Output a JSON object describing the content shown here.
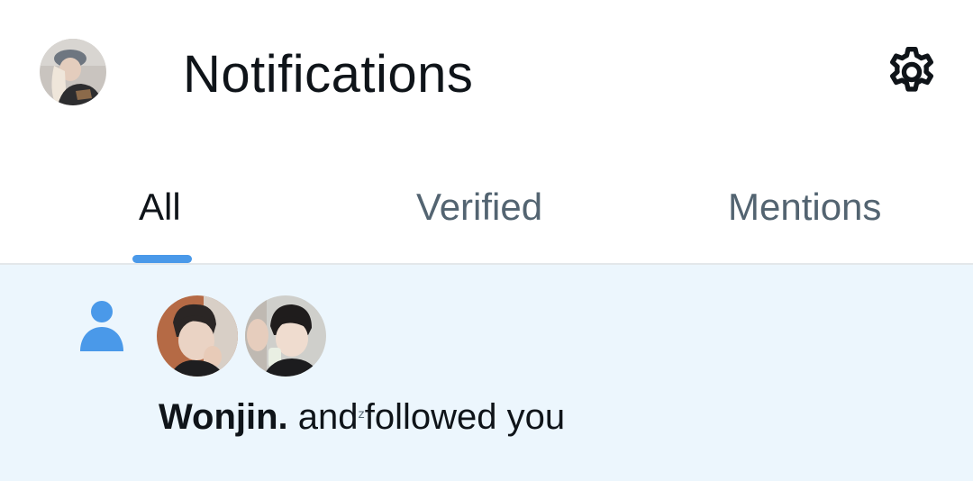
{
  "header": {
    "title": "Notifications",
    "profile_avatar": "profile-avatar",
    "settings_icon": "gear-icon"
  },
  "tabs": [
    {
      "label": "All",
      "active": true
    },
    {
      "label": "Verified",
      "active": false
    },
    {
      "label": "Mentions",
      "active": false
    }
  ],
  "notification": {
    "type_icon": "person-icon",
    "user_name": "Wonjin.",
    "message_and": "and",
    "message_mark": "ᶻ",
    "message_rest": "followed you"
  },
  "colors": {
    "accent": "#4a99e9",
    "unread_background": "#ecf6fd",
    "text_primary": "#0f1419",
    "text_secondary": "#536471"
  }
}
